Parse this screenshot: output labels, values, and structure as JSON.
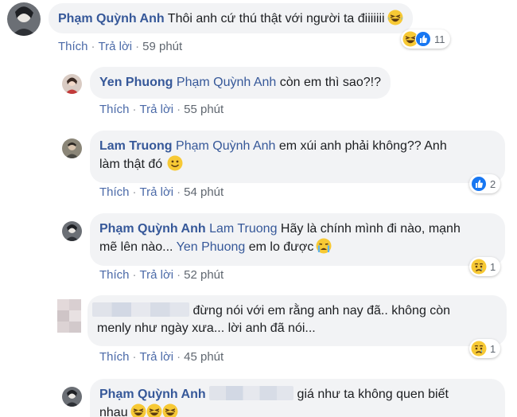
{
  "actions": {
    "like": "Thích",
    "reply": "Trả lời",
    "separator": "·"
  },
  "comments": [
    {
      "author": "Phạm Quỳnh Anh",
      "text": " Thôi anh cứ thú thật với người ta điiiiiii",
      "time": "59 phút",
      "reactions": {
        "icons": [
          "haha",
          "like"
        ],
        "count": "11"
      }
    },
    {
      "author": "Yen Phuong",
      "mention": "Phạm Quỳnh Anh",
      "text": " còn em thì sao?!?",
      "time": "55 phút"
    },
    {
      "author": "Lam Truong",
      "mention": "Phạm Quỳnh Anh",
      "text_line1": " em xúi anh phải không?? Anh",
      "text_line2": "làm thật đó",
      "time": "54 phút",
      "reactions": {
        "icons": [
          "like"
        ],
        "count": "2"
      }
    },
    {
      "author": "Phạm Quỳnh Anh",
      "mention": "Lam Truong",
      "text_line1": " Hãy là chính mình đi nào, mạnh",
      "text_line2a": "mẽ lên nào... ",
      "mention2": "Yen Phuong",
      "text_line2b": " em lo được",
      "time": "52 phút",
      "reactions": {
        "icons": [
          "sad"
        ],
        "count": "1"
      }
    },
    {
      "text_line1": " đừng nói với em rằng anh nay đã.. không còn",
      "text_line2": "menly như ngày xưa... lời anh đã nói...",
      "time": "45 phút",
      "reactions": {
        "icons": [
          "sad"
        ],
        "count": "1"
      }
    },
    {
      "author": "Phạm Quỳnh Anh",
      "text_line1": " giá như ta không quen biết",
      "text_line2": "nhau"
    }
  ],
  "colors": {
    "name": "#365899",
    "bubble": "#f2f3f5",
    "like": "#1877f2",
    "emoji": "#f7c935"
  }
}
